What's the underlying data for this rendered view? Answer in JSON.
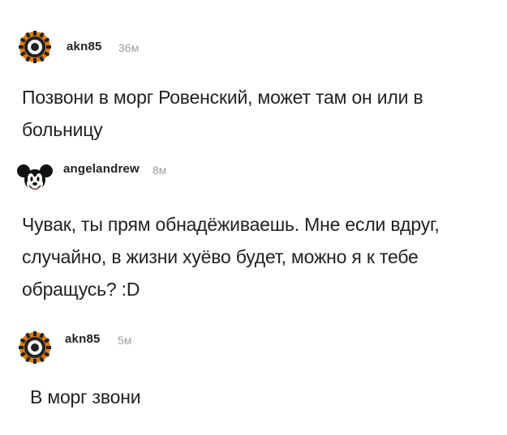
{
  "comments": [
    {
      "author": "akn85",
      "time": "36м",
      "avatar": "gear-avatar-icon",
      "text": "Позвони в морг Ровенский, может там он или в больницу"
    },
    {
      "author": "angelandrew",
      "time": "8м",
      "avatar": "mickey-avatar-icon",
      "text": "Чувак, ты прям обнадёживаешь. Мне если вдруг, случайно, в жизни хуёво будет, можно я к тебе обращусь? :D"
    },
    {
      "author": "akn85",
      "time": "5м",
      "avatar": "gear-avatar-icon",
      "text": "В морг звони"
    }
  ],
  "colors": {
    "gear_orange": "#e07a10",
    "gear_dark": "#222222",
    "time_gray": "#9e9e9e"
  }
}
